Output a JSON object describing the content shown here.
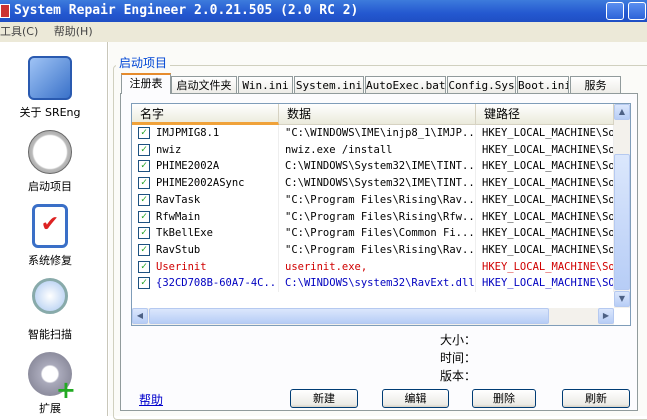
{
  "window": {
    "title": "System Repair Engineer 2.0.21.505 (2.0 RC 2)"
  },
  "menu": [
    "工具(C)",
    "帮助(H)"
  ],
  "sidebar": [
    {
      "label": "关于 SREng",
      "icon": "tools-icon"
    },
    {
      "label": "启动项目",
      "icon": "clock-icon"
    },
    {
      "label": "系统修复",
      "icon": "checklist-icon"
    },
    {
      "label": "智能扫描",
      "icon": "magnifier-icon"
    },
    {
      "label": "扩展",
      "icon": "gear-plus-icon"
    }
  ],
  "group_title": "启动项目",
  "tabs": [
    "注册表",
    "启动文件夹",
    "Win.ini",
    "System.ini",
    "AutoExec.bat",
    "Config.Sys",
    "Boot.ini",
    "服务"
  ],
  "columns": [
    "名字",
    "数据",
    "键路径"
  ],
  "rows": [
    {
      "name": "IMJPMIG8.1",
      "data": "\"C:\\WINDOWS\\IME\\injp8_1\\IMJP...",
      "path": "HKEY_LOCAL_MACHINE\\Sof",
      "color": "#000000"
    },
    {
      "name": "nwiz",
      "data": "nwiz.exe /install",
      "path": "HKEY_LOCAL_MACHINE\\Sof",
      "color": "#000000"
    },
    {
      "name": "PHIME2002A",
      "data": "C:\\WINDOWS\\System32\\IME\\TINT...",
      "path": "HKEY_LOCAL_MACHINE\\Sof",
      "color": "#000000"
    },
    {
      "name": "PHIME2002ASync",
      "data": "C:\\WINDOWS\\System32\\IME\\TINT...",
      "path": "HKEY_LOCAL_MACHINE\\Sof",
      "color": "#000000"
    },
    {
      "name": "RavTask",
      "data": "\"C:\\Program Files\\Rising\\Rav...",
      "path": "HKEY_LOCAL_MACHINE\\Sof",
      "color": "#000000"
    },
    {
      "name": "RfwMain",
      "data": "\"C:\\Program Files\\Rising\\Rfw...",
      "path": "HKEY_LOCAL_MACHINE\\Sof",
      "color": "#000000"
    },
    {
      "name": "TkBellExe",
      "data": "\"C:\\Program Files\\Common Fi...",
      "path": "HKEY_LOCAL_MACHINE\\Sof",
      "color": "#000000"
    },
    {
      "name": "RavStub",
      "data": "\"C:\\Program Files\\Rising\\Rav...",
      "path": "HKEY_LOCAL_MACHINE\\Sof",
      "color": "#000000"
    },
    {
      "name": "Userinit",
      "data": "userinit.exe,",
      "path": "HKEY_LOCAL_MACHINE\\Sof",
      "color": "#d00000"
    },
    {
      "name": "{32CD708B-60A7-4C...",
      "data": "C:\\WINDOWS\\system32\\RavExt.dll",
      "path": "HKEY_LOCAL_MACHINE\\SOF",
      "color": "#0000c0"
    }
  ],
  "info": {
    "size": "大小：",
    "time": "时间：",
    "version": "版本："
  },
  "help_link": "帮助",
  "buttons": {
    "new": "新建",
    "edit": "编辑",
    "delete": "删除",
    "refresh": "刷新"
  }
}
